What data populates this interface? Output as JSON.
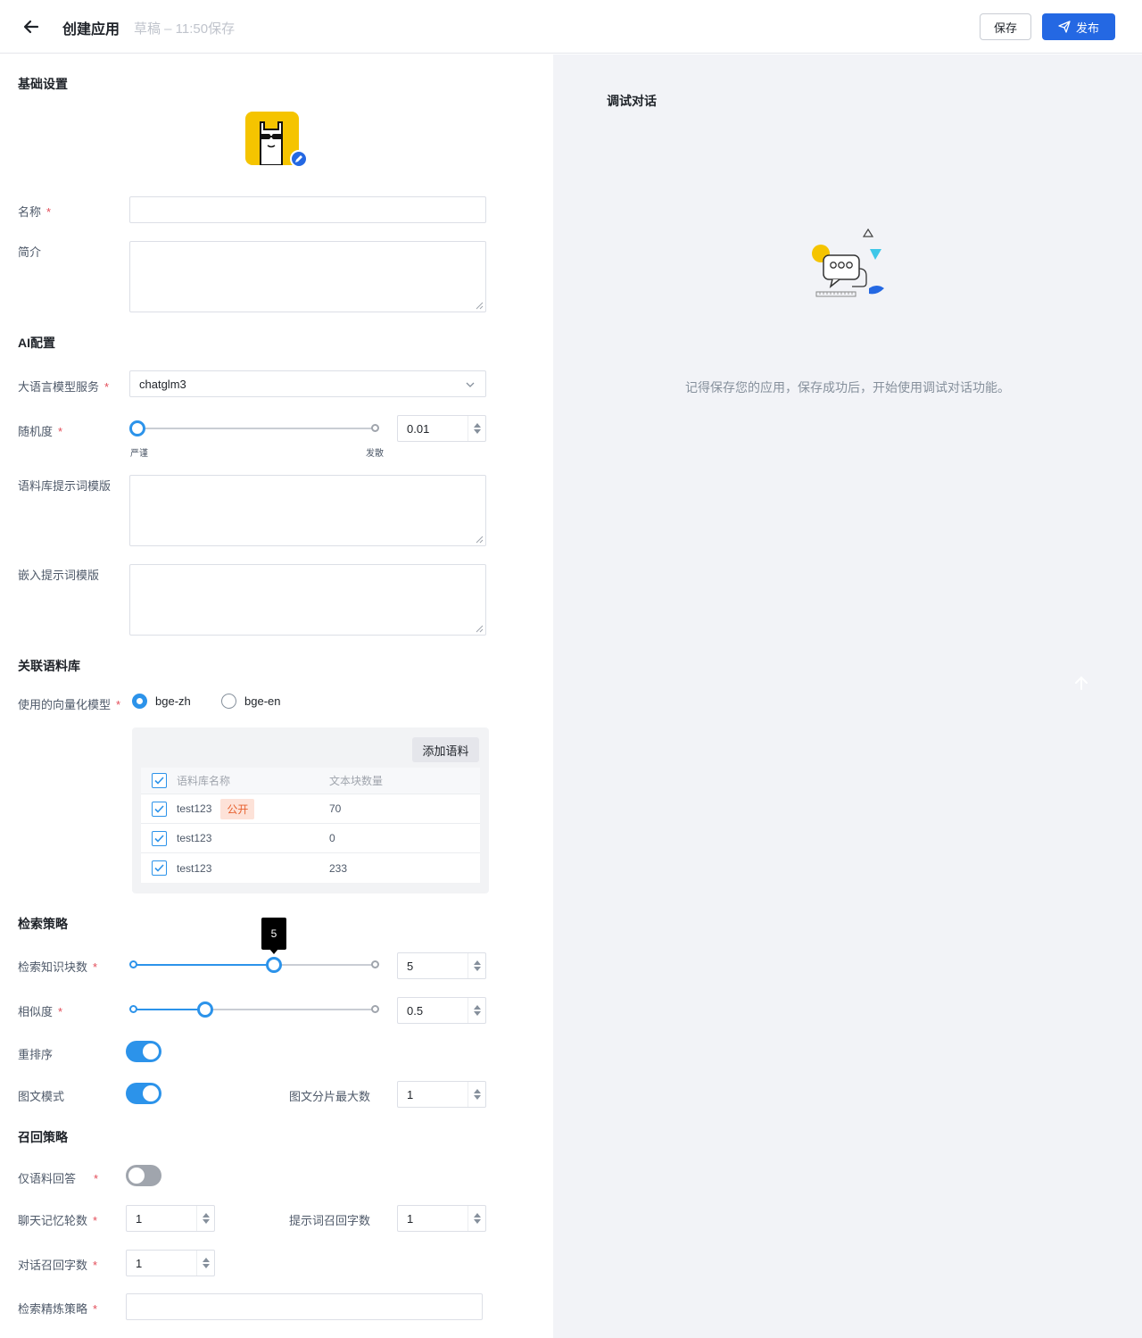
{
  "header": {
    "title": "创建应用",
    "draft_status": "草稿 – 11:50保存",
    "save_label": "保存",
    "publish_label": "发布"
  },
  "basic": {
    "section_title": "基础设置",
    "name_label": "名称",
    "name_value": "",
    "intro_label": "简介",
    "intro_value": ""
  },
  "ai": {
    "section_title": "AI配置",
    "llm_label": "大语言模型服务",
    "llm_value": "chatglm3",
    "randomness_label": "随机度",
    "randomness_value": "0.01",
    "randomness_min_label": "严谨",
    "randomness_max_label": "发散",
    "corpus_prompt_label": "语料库提示词模版",
    "embed_prompt_label": "嵌入提示词模版"
  },
  "corpus": {
    "section_title": "关联语料库",
    "vector_model_label": "使用的向量化模型",
    "vector_options": [
      "bge-zh",
      "bge-en"
    ],
    "vector_selected": "bge-zh",
    "add_label": "添加语料",
    "columns": [
      "语料库名称",
      "文本块数量"
    ],
    "rows": [
      {
        "name": "test123",
        "badge": "公开",
        "count": "70"
      },
      {
        "name": "test123",
        "badge": "",
        "count": "0"
      },
      {
        "name": "test123",
        "badge": "",
        "count": "233"
      }
    ]
  },
  "retrieval": {
    "section_title": "检索策略",
    "chunks_label": "检索知识块数",
    "chunks_value": "5",
    "chunks_tooltip": "5",
    "chunks_fraction": 0.57,
    "similarity_label": "相似度",
    "similarity_value": "0.5",
    "similarity_fraction": 0.29,
    "rerank_label": "重排序",
    "rerank_on": true,
    "imagetext_label": "图文模式",
    "imagetext_on": true,
    "imagetext_max_label": "图文分片最大数",
    "imagetext_max_value": "1"
  },
  "recall": {
    "section_title": "召回策略",
    "only_corpus_label": "仅语料回答",
    "only_corpus_on": false,
    "memory_label": "聊天记忆轮数",
    "memory_value": "1",
    "prompt_recall_label": "提示词召回字数",
    "prompt_recall_value": "1",
    "dialog_recall_label": "对话召回字数",
    "dialog_recall_value": "1",
    "refine_label": "检索精炼策略",
    "refine_value": ""
  },
  "debug": {
    "title": "调试对话",
    "empty_text": "记得保存您的应用，保存成功后，开始使用调试对话功能。"
  },
  "colors": {
    "primary": "#2468e3",
    "accent": "#2c93ea",
    "badge_bg": "#fde2d8",
    "badge_text": "#e7602e",
    "required": "#e34d59"
  }
}
